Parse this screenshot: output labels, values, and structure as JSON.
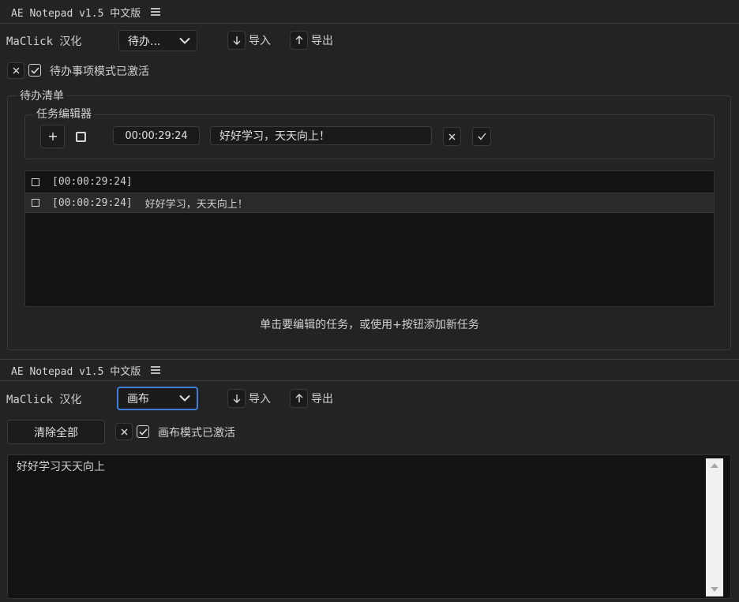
{
  "panel1": {
    "title": "AE Notepad v1.5 中文版",
    "maclick_label": "MaClick 汉化",
    "mode_select": "待办...",
    "import_label": "导入",
    "export_label": "导出",
    "mode_status": "待办事项模式已激活",
    "todo_group_label": "待办清单",
    "editor_group_label": "任务编辑器",
    "timecode": "00:00:29:24",
    "task_input_value": "好好学习，天天向上！",
    "tasks": [
      {
        "time": "[00:00:29:24]",
        "text": ""
      },
      {
        "time": "[00:00:29:24]",
        "text": "好好学习，天天向上！"
      }
    ],
    "hint": "单击要编辑的任务，或使用+按钮添加新任务"
  },
  "panel2": {
    "title": "AE Notepad v1.5 中文版",
    "maclick_label": "MaClick 汉化",
    "mode_select": "画布",
    "import_label": "导入",
    "export_label": "导出",
    "clear_all_label": "清除全部",
    "mode_status": "画布模式已激活",
    "canvas_text": "好好学习天天向上"
  },
  "icons": {
    "menu": "hamburger-icon",
    "dropdown": "chevron-down-icon",
    "import": "arrow-down-icon",
    "export": "arrow-up-icon",
    "close": "close-icon",
    "check": "check-icon",
    "add": "plus-icon"
  },
  "colors": {
    "background": "#232323",
    "focus_border": "#3d7fd9",
    "list_bg": "#131313"
  }
}
